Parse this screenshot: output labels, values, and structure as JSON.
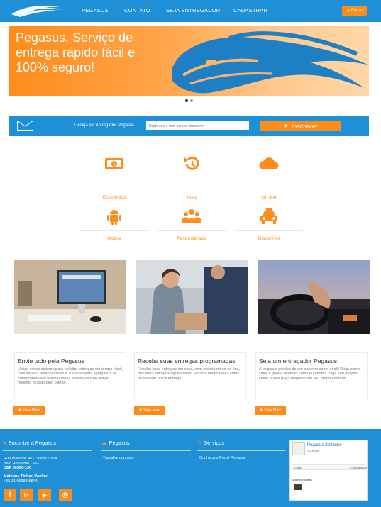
{
  "navbar": {
    "links": [
      "PEGASUS",
      "CONTATO",
      "SEJA ENTREGADOR",
      "CADASTRAR"
    ],
    "login_label": "Entrar"
  },
  "hero": {
    "text": "Pegasus. Serviço de entrega rápido fácil e 100% seguro!"
  },
  "subscribe": {
    "label": "Deseja ser entregador Pegasus",
    "placeholder": "Digite seu e-mail para se inscrever",
    "button": "Inscrever"
  },
  "features": [
    {
      "label": "Econômico",
      "icon": "money-icon"
    },
    {
      "label": "Veloz",
      "icon": "history-icon"
    },
    {
      "label": "On-line",
      "icon": "cloud-icon"
    },
    {
      "label": "Mobile",
      "icon": "android-icon"
    },
    {
      "label": "Personalizado",
      "icon": "users-icon"
    },
    {
      "label": "Disponível",
      "icon": "taxi-icon"
    }
  ],
  "cards": [
    {
      "title": "Envie tudo pela Pegasus",
      "text": "Utilize nosso sistema para solicitar entregas em tempo hábil, com serviço personalizado e 100% seguro. A pegasus se compromete em realizar todas solicitações no tempo máximo exigido pelo cliente.",
      "button": "Veja Mais"
    },
    {
      "title": "Receba suas entregas programadas",
      "text": "Receba suas entregas em casa, com rastreamento on-line, das suas entregas aguardadas. Receba notificações antes de receber a sua entrega.",
      "button": "Veja Mais"
    },
    {
      "title": "Seja um entregador Pegasus",
      "text": "A pegasus precisa de um parceiro como você! Dirija com a Uber e ganhe dinheiro como autônomo. Seja seu próprio chefe e seja pago dirigindo em seu próprio horário.",
      "button": "Veja Mais"
    }
  ],
  "footer": {
    "col1_title": "Encontre a Pegasus",
    "address1": "Rua Pifiados, 451, Santa Lúcia",
    "address2": "Belo Horizonte - MG",
    "cep": "CEP 30360-190",
    "contact_name": "Matheus Thibau Paulino",
    "phone": "+55 31 99988-5874",
    "col2_title": "Pegasus",
    "col2_link": "Trabalhe conosco",
    "col3_title": "Serviços",
    "col3_link": "Conheça o Portal Pegasus",
    "fb_name": "Pegasus Software",
    "fb_likes": "2 curtidas",
    "fb_like_btn": "Curtir",
    "fb_share_btn": "Compartilhar",
    "fb_post": "Você curtiu isso"
  },
  "colors": {
    "primary_blue": "#1f8fd6",
    "accent_orange": "#ff8c1a"
  }
}
